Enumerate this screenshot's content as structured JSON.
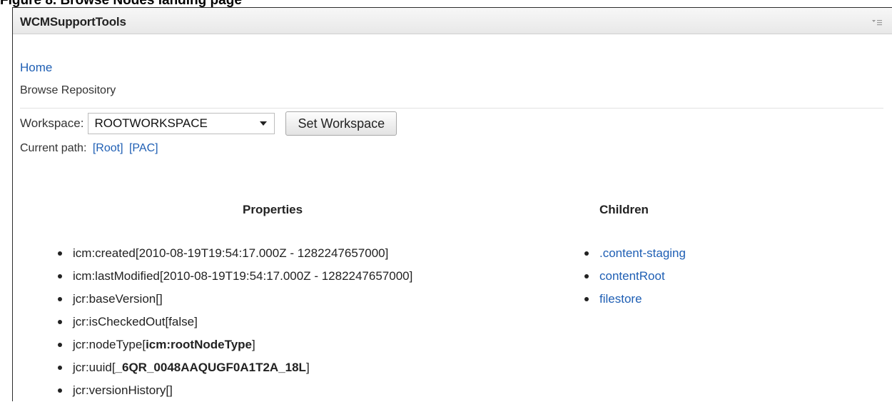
{
  "figure_caption": "Figure 8. Browse Nodes landing page",
  "portlet": {
    "title": "WCMSupportTools"
  },
  "nav": {
    "home_label": "Home",
    "breadcrumb": "Browse Repository"
  },
  "workspace": {
    "label": "Workspace:",
    "selected": "ROOTWORKSPACE",
    "set_button": "Set Workspace"
  },
  "current_path": {
    "label": "Current path:",
    "segments": [
      "[Root]",
      "[PAC]"
    ]
  },
  "properties": {
    "heading": "Properties",
    "items": [
      {
        "name": "icm:created",
        "open": "[",
        "value": "2010-08-19T19:54:17.000Z - 1282247657000",
        "close": "]",
        "bold": false
      },
      {
        "name": "icm:lastModified",
        "open": "[",
        "value": "2010-08-19T19:54:17.000Z - 1282247657000",
        "close": "]",
        "bold": false
      },
      {
        "name": "jcr:baseVersion",
        "open": "[",
        "value": "",
        "close": "]",
        "bold": false
      },
      {
        "name": "jcr:isCheckedOut",
        "open": "[",
        "value": "false",
        "close": "]",
        "bold": false
      },
      {
        "name": "jcr:nodeType",
        "open": "[",
        "value": "icm:rootNodeType",
        "close": "]",
        "bold": true
      },
      {
        "name": "jcr:uuid",
        "open": "[",
        "value": "_6QR_0048AAQUGF0A1T2A_18L",
        "close": "]",
        "bold": true
      },
      {
        "name": "jcr:versionHistory",
        "open": "[",
        "value": "",
        "close": "]",
        "bold": false
      }
    ]
  },
  "children": {
    "heading": "Children",
    "items": [
      ".content-staging",
      "contentRoot",
      "filestore"
    ]
  },
  "icons": {
    "portlet_menu": "menu-icon",
    "select_caret": "chevron-down-icon"
  },
  "colors": {
    "link": "#1f5fb4",
    "titlebar": "#eeeeee"
  }
}
